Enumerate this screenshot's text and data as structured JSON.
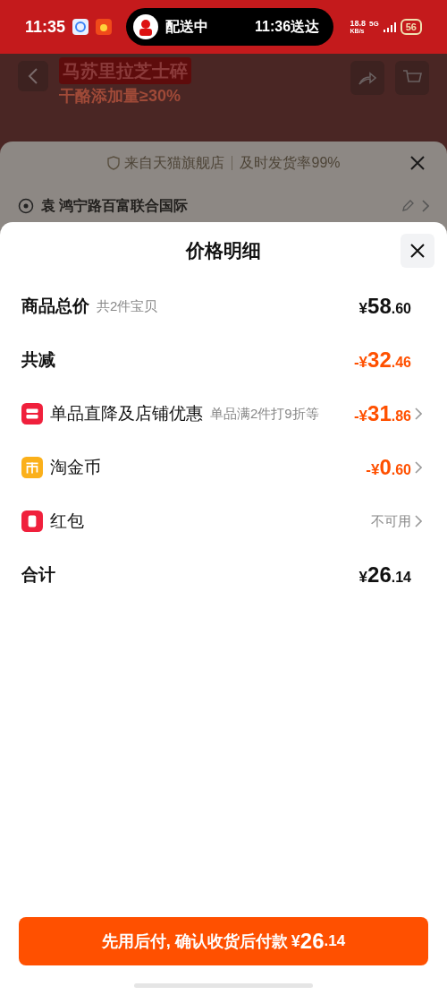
{
  "status_bar": {
    "time": "11:35",
    "island": {
      "label": "配送中",
      "eta": "11:36送达"
    },
    "speed": "18.8",
    "speed_unit": "KB/s",
    "network": "5G",
    "battery": "56"
  },
  "banner": {
    "title": "马苏里拉芝士碎",
    "lines": [
      "干酪添加量≥30%"
    ]
  },
  "store_sheet": {
    "store": "来自天猫旗舰店",
    "rate": "及时发货率99%",
    "address": "袁 鸿宁路百富联合国际"
  },
  "sheet": {
    "title": "价格明细",
    "rows": [
      {
        "kind": "header",
        "label": "商品总价",
        "note": "共2件宝贝",
        "amount": {
          "sign": "¥",
          "whole": "58",
          "cents": ".60"
        },
        "discount": false
      },
      {
        "kind": "header",
        "label": "共减",
        "amount": {
          "sign": "-¥",
          "whole": "32",
          "cents": ".46"
        },
        "discount": true
      },
      {
        "kind": "item",
        "label": "单品直降及店铺优惠",
        "note": "单品满2件打9折等",
        "amount": {
          "sign": "-¥",
          "whole": "31",
          "cents": ".86"
        },
        "discount": true,
        "color": "#f0203c"
      },
      {
        "kind": "item",
        "label": "淘金币",
        "amount": {
          "sign": "-¥",
          "whole": "0",
          "cents": ".60"
        },
        "discount": true,
        "color": "#fbb01a"
      },
      {
        "kind": "item",
        "label": "红包",
        "status": "不可用",
        "color": "#f0203c"
      },
      {
        "kind": "header",
        "label": "合计",
        "amount": {
          "sign": "¥",
          "whole": "26",
          "cents": ".14"
        },
        "discount": false
      }
    ]
  },
  "pay_button": {
    "label": "先用后付, 确认收货后付款",
    "amount": {
      "sign": "¥",
      "whole": "26",
      "cents": ".14"
    }
  }
}
